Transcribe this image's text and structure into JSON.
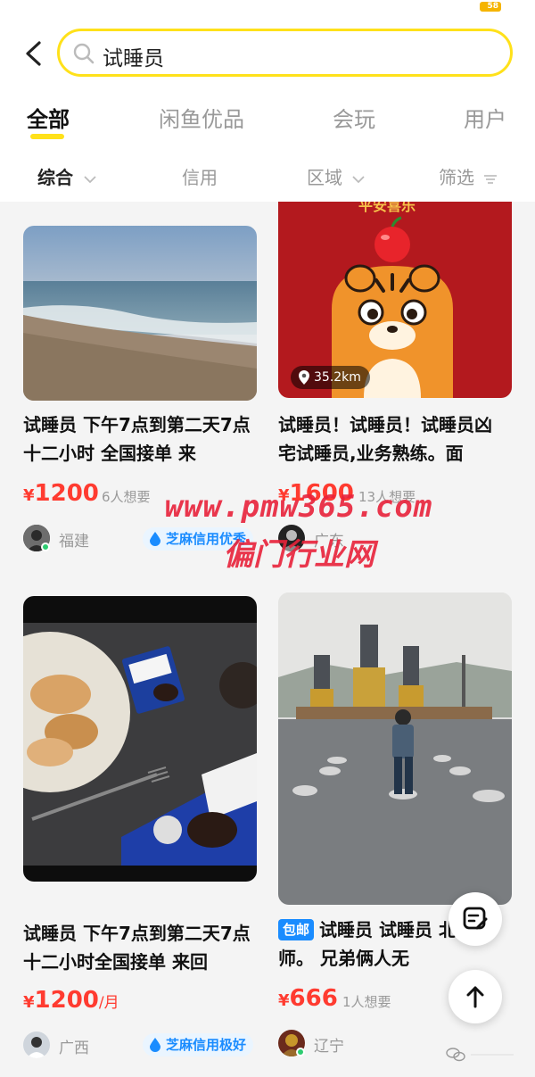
{
  "search": {
    "query": "试睡员"
  },
  "tabs": [
    {
      "label": "全部",
      "active": true
    },
    {
      "label": "闲鱼优品",
      "active": false
    },
    {
      "label": "会玩",
      "active": false
    },
    {
      "label": "用户",
      "active": false
    }
  ],
  "filters": [
    {
      "label": "综合",
      "active": true,
      "chevron": "chevron-down-icon"
    },
    {
      "label": "信用",
      "active": false
    },
    {
      "label": "区域",
      "active": false,
      "chevron": "chevron-down-icon"
    },
    {
      "label": "筛选",
      "active": false,
      "icon": "filter-icon"
    }
  ],
  "cards": [
    {
      "image": "beach-photo",
      "title": "试睡员 下午7点到第二天7点 十二小时 全国接单 来",
      "price_symbol": "¥",
      "price": "1200",
      "price_unit": "",
      "wants": "6人想要",
      "region": "福建",
      "badge": "芝麻信用优秀"
    },
    {
      "image": "tiger-apple-illustration",
      "distance": "35.2km",
      "title": "试睡员！试睡员！试睡员凶宅试睡员,业务熟练。面",
      "price_symbol": "¥",
      "price": "1600",
      "price_unit": "",
      "wants": "13人想要",
      "region": "广东",
      "badge": ""
    },
    {
      "image": "coffee-pastry-photo",
      "title": "试睡员 下午7点到第二天7点十二小时全国接单 来回",
      "price_symbol": "¥",
      "price": "1200",
      "price_unit": "/月",
      "wants": "",
      "region": "广西",
      "badge": "芝麻信用极好"
    },
    {
      "image": "temple-square-photo",
      "tag": "包邮",
      "title": "试睡员 试睡员 北小法师。 兄弟俩人无",
      "price_symbol": "¥",
      "price": "666",
      "price_unit": "",
      "wants": "1人想要",
      "region": "辽宁",
      "badge": ""
    }
  ],
  "watermark": {
    "url": "www.pmw365.com",
    "name": "偏门行业网"
  },
  "status": {
    "battery": "58"
  },
  "colors": {
    "accent": "#ffe11a",
    "price": "#ff3b30",
    "badge": "#1a8cff"
  }
}
